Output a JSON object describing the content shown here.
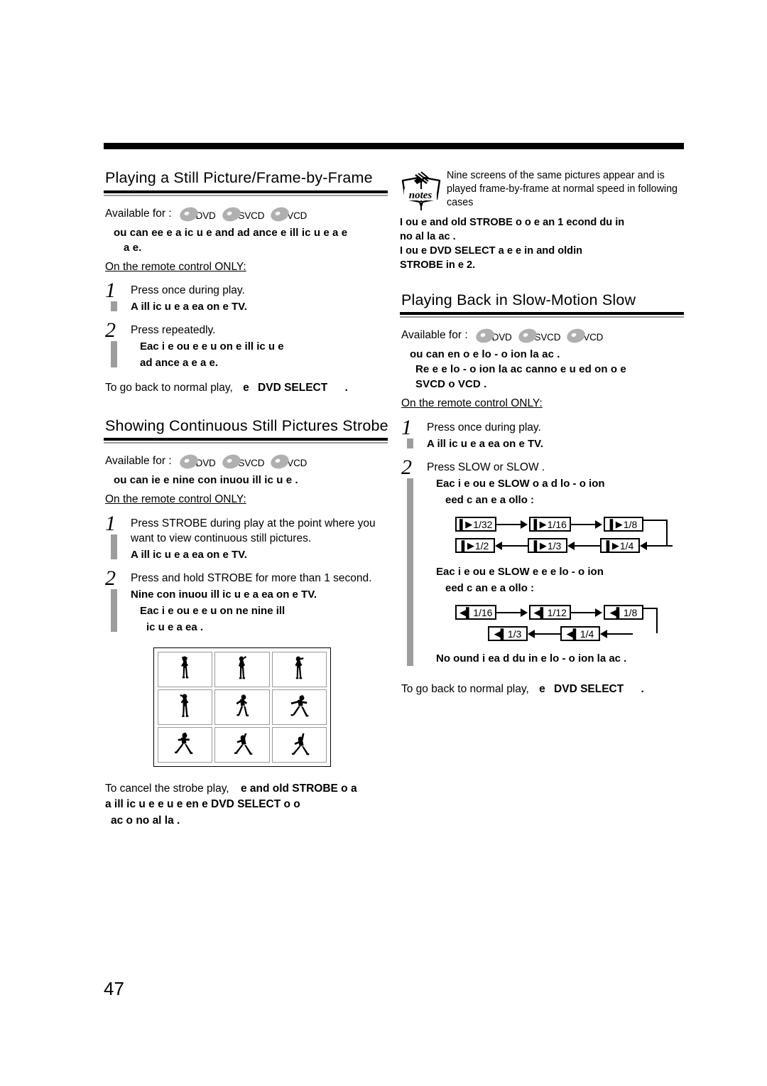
{
  "page": {
    "number": "47"
  },
  "left_column": {
    "section1": {
      "title": "Playing a Still Picture/Frame-by-Frame",
      "available_label": "Available for :",
      "discs": [
        "DVD",
        "SVCD",
        "VCD"
      ],
      "intro_bold_lines": [
        "ou can  ee e a  ic u e and ad ance   e  ill  ic u e  a  e",
        "a  e."
      ],
      "remote_note": "On the remote control ONLY:",
      "steps": [
        {
          "num": "1",
          "text": "Press   once during play.",
          "bold": [
            "A  ill  ic u e a  ea  on   e TV."
          ]
        },
        {
          "num": "2",
          "text": "Press   repeatedly.",
          "bold": [
            "Eac   i e  ou   e    e  u  on   e  ill  ic u e",
            "ad ance   a  e    a  e."
          ]
        }
      ],
      "closing_prefix": "To go back to normal play,",
      "closing_bold_a": "e",
      "closing_bold_b": "DVD SELECT",
      "closing_suffix": "."
    },
    "section2": {
      "title": "Showing Continuous Still Pictures  Strobe",
      "available_label": "Available for :",
      "discs": [
        "DVD",
        "SVCD",
        "VCD"
      ],
      "intro_bold_lines": [
        "ou can  ie    e nine con inuou   ill  ic u e ."
      ],
      "remote_note": "On the remote control ONLY:",
      "steps": [
        {
          "num": "1",
          "text": "Press STROBE during play at the point where you want to view continuous still pictures.",
          "bold": [
            "A  ill  ic u e a  ea  on   e TV."
          ]
        },
        {
          "num": "2",
          "text": "Press and hold STROBE for more than 1 second.",
          "bold": [
            "Nine con inuou   ill  ic u e a  ea  on   e TV."
          ],
          "bold_indent": [
            "Eac   i e  ou   e    e  u  on  ne nine  ill",
            "ic u e a  ea ."
          ]
        }
      ],
      "strobe_grid_caption": "nine-still-picture-strobe-illustration",
      "closing_prefix": "To cancel the strobe play,",
      "closing_bold_lines": [
        "e   and  old STROBE   o   a",
        "a  ill  ic u e  e u e    en   e  DVD SELECT     o  o",
        "ac   o no  al  la ."
      ]
    }
  },
  "right_column": {
    "notes": {
      "icon_label": "notes",
      "lines": [
        "Nine screens of the same pictures appear and is",
        "played frame-by-frame at normal speed in following",
        "cases"
      ],
      "bold_lines": [
        "I   ou   e   and  old STROBE  o    o e   an 1  econd du in",
        "no  al  la  ac .",
        "I   ou   e   DVD SELECT     a  e    e  in  and  oldin",
        "STROBE in   e  2."
      ]
    },
    "section3": {
      "title": "Playing Back in Slow-Motion  Slow",
      "available_label": "Available for :",
      "discs": [
        "DVD",
        "SVCD",
        "VCD"
      ],
      "intro_bold_lines": [
        "ou can en o     e  lo - o ion  la  ac .",
        "Re e  e  lo - o ion  la  ac  canno   e u ed on  o e",
        "SVCD  o  VCD ."
      ],
      "remote_note": "On the remote control ONLY:",
      "steps": [
        {
          "num": "1",
          "text": "Press   once during play.",
          "bold": [
            "A  ill  ic u e a  ea  on   e TV."
          ]
        },
        {
          "num": "2",
          "text": "Press SLOW   or SLOW  .",
          "bold": [
            "Eac   i e  ou   e  SLOW    o  a d  lo - o ion",
            "eed c an e a   ollo  :"
          ],
          "bold2": [
            "Eac   i e  ou   e  SLOW    e e  e  lo - o ion",
            "eed c an e a   ollo  :"
          ]
        }
      ],
      "forward_flow": {
        "row1": [
          "1/32",
          "1/16",
          "1/8"
        ],
        "row2": [
          "1/2",
          "1/3",
          "1/4"
        ],
        "glyph": "forward-slow-icon"
      },
      "reverse_flow": {
        "row1": [
          "1/16",
          "1/12",
          "1/8"
        ],
        "row2": [
          "1/3",
          "1/4"
        ],
        "glyph": "reverse-slow-icon"
      },
      "no_sound_bold": "No  ound i   ea d du in    e  lo - o ion  la  ac .",
      "closing_prefix": "To go back to normal play,",
      "closing_bold_a": "e",
      "closing_bold_b": "DVD SELECT",
      "closing_suffix": "."
    }
  }
}
